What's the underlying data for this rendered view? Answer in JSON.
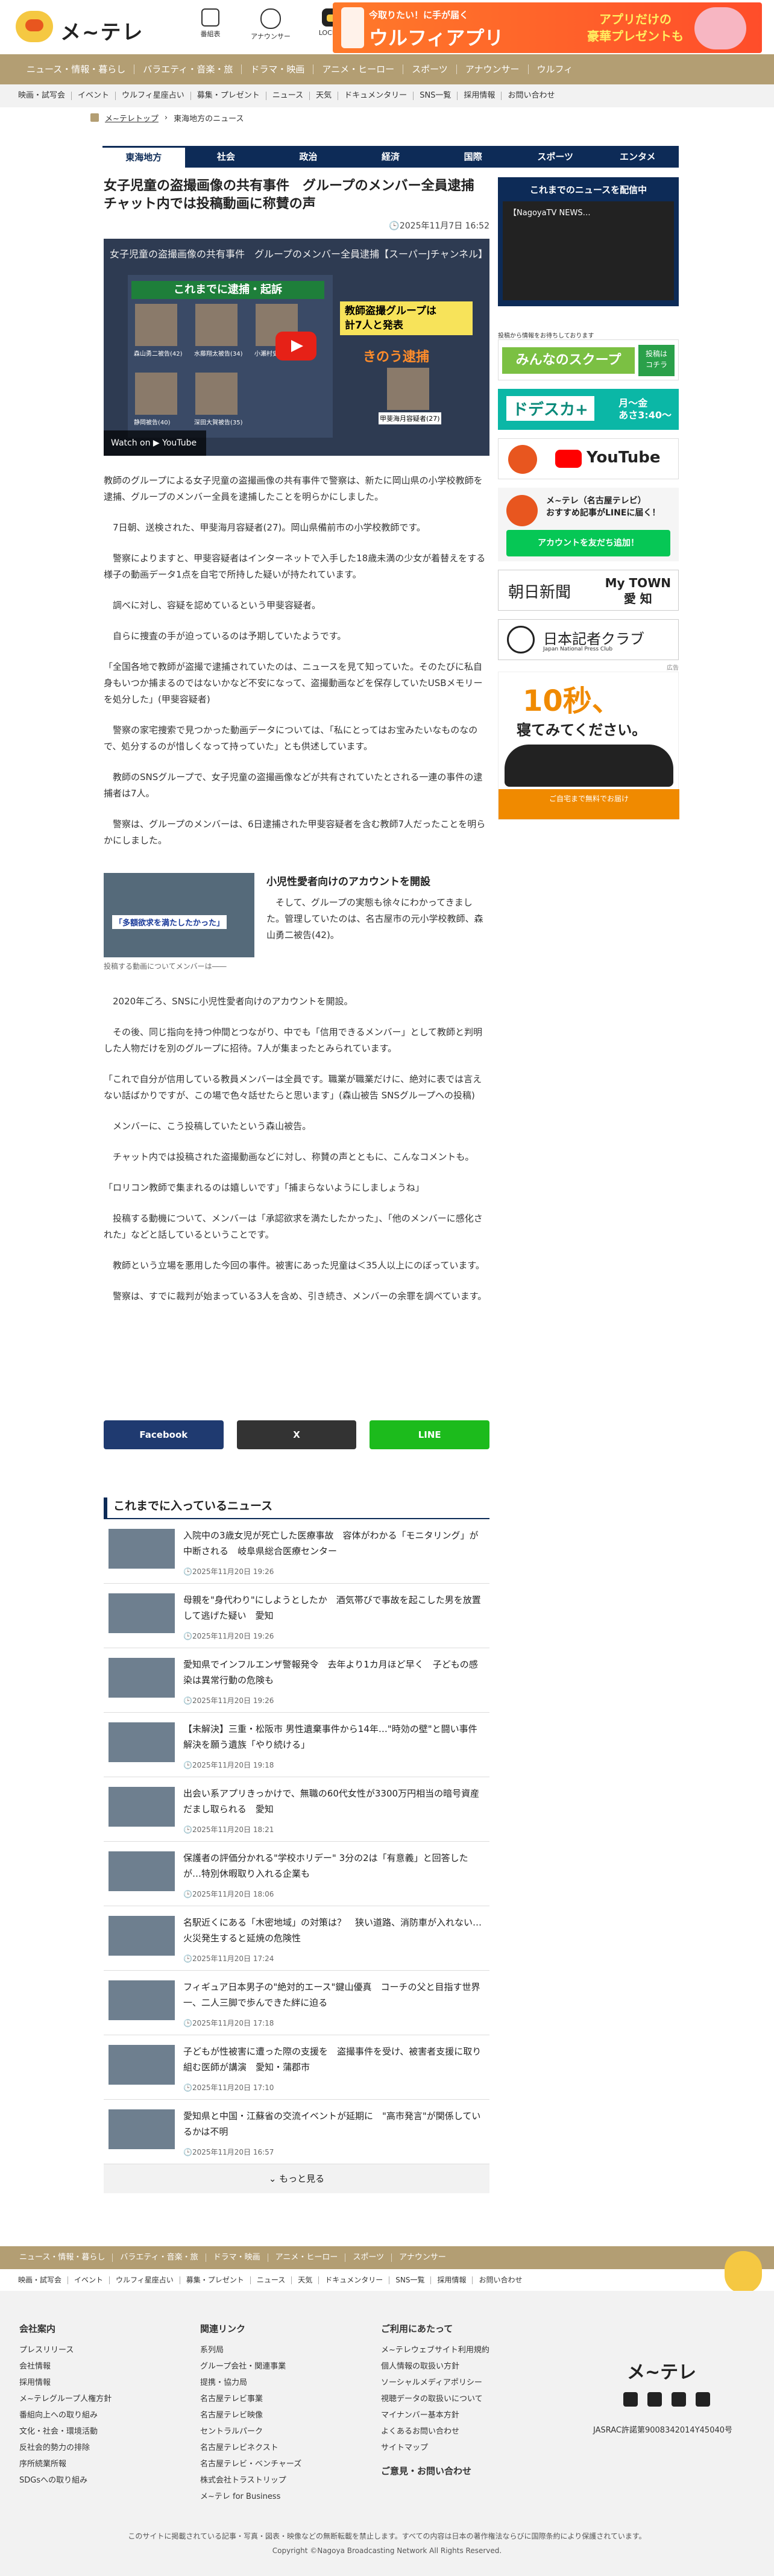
{
  "header": {
    "logo": "メ~テレ",
    "icons": [
      {
        "label": "番組表",
        "icon": "tv-icon"
      },
      {
        "label": "アナウンサー",
        "icon": "announcer-icon"
      },
      {
        "label": "LOCIPO",
        "icon": "locipo-icon"
      }
    ],
    "banner": {
      "line1": "今取りたい！に手が届く",
      "line2": "ウルフィアプリ",
      "line3": "アプリだけの\n豪華プレゼントも"
    }
  },
  "nav_main": [
    "ニュース・情報・暮らし",
    "バラエティ・音楽・旅",
    "ドラマ・映画",
    "アニメ・ヒーロー",
    "スポーツ",
    "アナウンサー",
    "ウルフィ"
  ],
  "nav_sub": [
    "映画・試写会",
    "イベント",
    "ウルフィ星座占い",
    "募集・プレゼント",
    "ニュース",
    "天気",
    "ドキュメンタリー",
    "SNS一覧",
    "採用情報",
    "お問い合わせ"
  ],
  "breadcrumb": [
    "メ~テレトップ",
    "東海地方のニュース"
  ],
  "category_tabs": [
    "東海地方",
    "社会",
    "政治",
    "経済",
    "国際",
    "スポーツ",
    "エンタメ"
  ],
  "article": {
    "title": "女子児童の盗撮画像の共有事件　グループのメンバー全員逮捕　チャット内では投稿動画に称賛の声",
    "date": "🕒2025年11月7日 16:52",
    "video": {
      "title": "女子児童の盗撮画像の共有事件　グループのメンバー全員逮捕【スーパーJチャンネル】",
      "panel_title": "これまでに逮捕・起訴",
      "names": [
        "森山勇二被告(42)",
        "水藤翔太被告(34)",
        "小瀬村史也被告",
        "静岡被告(40)",
        "深田大賀被告(35)",
        "甲斐海月容疑者(27)"
      ],
      "yellow": "教師盗撮グループは\n計7人と発表",
      "orange": "きのう逮捕",
      "watch": "Watch on ▶ YouTube"
    },
    "paragraphs": [
      "教師のグループによる女子児童の盗撮画像の共有事件で警察は、新たに岡山県の小学校教師を逮捕、グループのメンバー全員を逮捕したことを明らかにしました。",
      "7日朝、送検された、甲斐海月容疑者(27)。岡山県備前市の小学校教師です。",
      "警察によりますと、甲斐容疑者はインターネットで入手した18歳未満の少女が着替えをする様子の動画データ1点を自宅で所持した疑いが持たれています。",
      "調べに対し、容疑を認めているという甲斐容疑者。",
      "自らに捜査の手が迫っているのは予期していたようです。",
      "「全国各地で教師が盗撮で逮捕されていたのは、ニュースを見て知っていた。そのたびに私自身もいつか捕まるのではないかなど不安になって、盗撮動画などを保存していたUSBメモリーを処分した」(甲斐容疑者)",
      "警察の家宅捜索で見つかった動画データについては、「私にとってはお宝みたいなものなので、処分するのが惜しくなって持っていた」とも供述しています。",
      "教師のSNSグループで、女子児童の盗撮画像などが共有されていたとされる一連の事件の逮捕者は7人。",
      "警察は、グループのメンバーは、6日逮捕された甲斐容疑者を含む教師7人だったことを明らかにしました。"
    ],
    "sub": {
      "heading": "小児性愛者向けのアカウントを開設",
      "caption": "投稿する動画についてメンバーは――",
      "image_text": "「多額欲求を満たしたかった」",
      "text": "そして、グループの実態も徐々にわかってきました。管理していたのは、名古屋市の元小学校教師、森山勇二被告(42)。"
    },
    "paragraphs2": [
      "2020年ごろ、SNSに小児性愛者向けのアカウントを開設。",
      "その後、同じ指向を持つ仲間とつながり、中でも「信用できるメンバー」として教師と判明した人物だけを別のグループに招待。7人が集まったとみられています。",
      "「これで自分が信用している教員メンバーは全員です。職業が職業だけに、絶対に表では言えない話ばかりですが、この場で色々話せたらと思います」(森山被告 SNSグループへの投稿)",
      "メンバーに、こう投稿していたという森山被告。",
      "チャット内では投稿された盗撮動画などに対し、称賛の声とともに、こんなコメントも。",
      "「ロリコン教師で集まれるのは嬉しいです」「捕まらないようにしましょうね」",
      "投稿する動機について、メンバーは「承認欲求を満たしたかった」、「他のメンバーに感化された」などと話しているということです。",
      "教師という立場を悪用した今回の事件。被害にあった児童は＜35人以上にのぼっています。",
      "警察は、すでに裁判が始まっている3人を含め、引き続き、メンバーの余罪を調べています。"
    ]
  },
  "shares": [
    {
      "label": "Facebook",
      "color": "#1f3a70"
    },
    {
      "label": "X",
      "color": "#333333"
    },
    {
      "label": "LINE",
      "color": "#1cbb1c"
    }
  ],
  "news": {
    "heading": "これまでに入っているニュース",
    "items": [
      {
        "title": "入院中の3歳女児が死亡した医療事故　容体がわかる「モニタリング」が中断される　岐阜県総合医療センター",
        "date": "🕒2025年11月20日 19:26"
      },
      {
        "title": "母親を\"身代わり\"にしようとしたか　酒気帯びで事故を起こした男を放置して逃げた疑い　愛知",
        "date": "🕒2025年11月20日 19:26"
      },
      {
        "title": "愛知県でインフルエンザ警報発令　去年より1カ月ほど早く　子どもの感染は異常行動の危険も",
        "date": "🕒2025年11月20日 19:26"
      },
      {
        "title": "【未解決】三重・松阪市 男性遺棄事件から14年…\"時効の壁\"と闘い事件解決を願う遺族「やり続ける」",
        "date": "🕒2025年11月20日 19:18"
      },
      {
        "title": "出会い系アプリきっかけで、無職の60代女性が3300万円相当の暗号資産だまし取られる　愛知",
        "date": "🕒2025年11月20日 18:21"
      },
      {
        "title": "保護者の評価分かれる\"学校ホリデー\" 3分の2は「有意義」と回答したが…特別休暇取り入れる企業も",
        "date": "🕒2025年11月20日 18:06"
      },
      {
        "title": "名駅近くにある「木密地域」の対策は？　狭い道路、消防車が入れない…火災発生すると延焼の危険性",
        "date": "🕒2025年11月20日 17:24"
      },
      {
        "title": "フィギュア日本男子の\"絶対的エース\"鍵山優真　コーチの父と目指す世界一、二人三脚で歩んできた絆に迫る",
        "date": "🕒2025年11月20日 17:18"
      },
      {
        "title": "子どもが性被害に遭った際の支援を　盗撮事件を受け、被害者支援に取り組む医師が講演　愛知・蒲郡市",
        "date": "🕒2025年11月20日 17:10"
      },
      {
        "title": "愛知県と中国・江蘇省の交流イベントが延期に　\"高市発言\"が関係しているかは不明",
        "date": "🕒2025年11月20日 16:57"
      }
    ],
    "more": "⌄ もっと見る"
  },
  "sidebar": {
    "live_heading": "これまでのニュースを配信中",
    "live_video": "【NagoyaTV NEWS…",
    "minna": "みんなのスクープ",
    "minna_top": "投稿から情報をお待ちしております",
    "minna_side": "投稿は\nコチラ",
    "dosu": "ドデスカ+",
    "dosu_time": "月〜金\nあさ3:40〜",
    "youtube": "YouTube",
    "line_text": "メ~テレ（名古屋テレビ）\nおすすめ記事がLINEに届く！",
    "line_btn": "アカウントを友だち追加！",
    "asahi": "朝日新聞",
    "mytown": "My TOWN\n愛 知",
    "nk": "日本記者クラブ",
    "nk_sub": "Japan National Press Club",
    "ad_tag": "広告",
    "ad1": "10秒、",
    "ad2": "寝てみてください。",
    "ad3": "ご自宅まで無料でお届け"
  },
  "footer_nav_main": [
    "ニュース・情報・暮らし",
    "バラエティ・音楽・旅",
    "ドラマ・映画",
    "アニメ・ヒーロー",
    "スポーツ",
    "アナウンサー"
  ],
  "footer_nav_sub": [
    "映画・試写会",
    "イベント",
    "ウルフィ星座占い",
    "募集・プレゼント",
    "ニュース",
    "天気",
    "ドキュメンタリー",
    "SNS一覧",
    "採用情報",
    "お問い合わせ"
  ],
  "footer": {
    "col1": {
      "heading": "会社案内",
      "items": [
        "プレスリリース",
        "会社情報",
        "採用情報",
        "メ~テレグループ人権方針",
        "番組向上への取り組み",
        "文化・社会・環境活動",
        "反社会的勢力の排除",
        "序所続業所報",
        "SDGsへの取り組み"
      ]
    },
    "col2": {
      "heading": "関連リンク",
      "items": [
        "系列局",
        "グループ会社・関連事業",
        "提携・協力局",
        "名古屋テレビ事業",
        "名古屋テレビ映像",
        "セントラルパーク",
        "名古屋テレビネクスト",
        "名古屋テレビ・ベンチャーズ",
        "株式会社トラストリップ",
        "メ~テレ for Business"
      ]
    },
    "col3": {
      "heading": "ご利用にあたって",
      "items": [
        "メ~テレウェブサイト利用規約",
        "個人情報の取扱い方針",
        "ソーシャルメディアポリシー",
        "視聴データの取扱いについて",
        "マイナンバー基本方針",
        "よくあるお問い合わせ",
        "サイトマップ"
      ],
      "extra": "ご意見・お問い合わせ"
    },
    "logo": "メ~テレ",
    "jasrac": "JASRAC許諾第9008342014Y45040号",
    "note": "このサイトに掲載されている記事・写真・図表・映像などの無断転載を禁止します。すべての内容は日本の著作権法ならびに国際条約により保護されています。",
    "copyright": "Copyright ©Nagoya Broadcasting Network All Rights Reserved."
  }
}
